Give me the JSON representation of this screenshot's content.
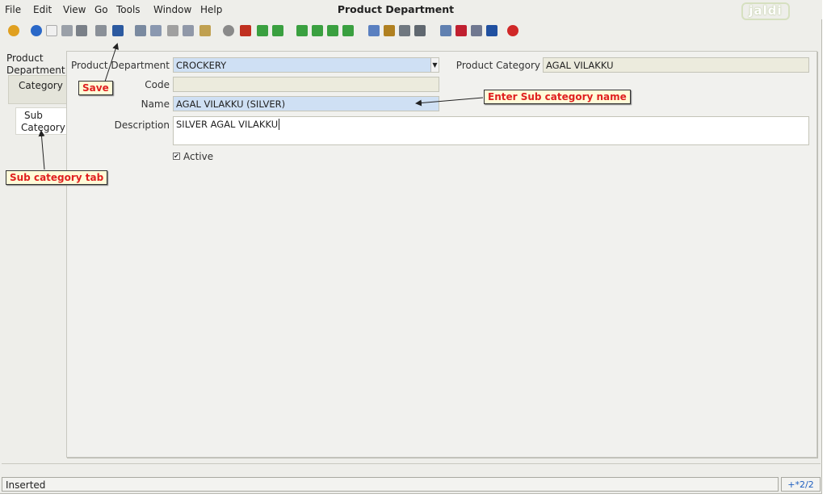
{
  "menu": {
    "file": "File",
    "edit": "Edit",
    "view": "View",
    "go": "Go",
    "tools": "Tools",
    "window": "Window",
    "help": "Help"
  },
  "window_title": "Product Department",
  "logo_text": "jaldi",
  "toolbar_icons": [
    {
      "name": "undo-icon",
      "color": "#e0a020"
    },
    {
      "name": "help-icon",
      "color": "#2a68c8"
    },
    {
      "name": "new-record-icon",
      "color": "#f0f0f0"
    },
    {
      "name": "copy-record-icon",
      "color": "#9aa0a8"
    },
    {
      "name": "delete-record-icon",
      "color": "#7a8088"
    },
    {
      "name": "delete-selection-icon",
      "color": "#8a9098"
    },
    {
      "name": "save-icon",
      "color": "#2c5aa0"
    },
    {
      "name": "refresh-icon",
      "color": "#7a8aa0"
    },
    {
      "name": "find-icon",
      "color": "#8a98b0"
    },
    {
      "name": "attachment-icon",
      "color": "#a0a0a0"
    },
    {
      "name": "chat-icon",
      "color": "#9098a8"
    },
    {
      "name": "grid-toggle-icon",
      "color": "#c0a050"
    },
    {
      "name": "history-icon",
      "color": "#8a8a8a"
    },
    {
      "name": "home-icon",
      "color": "#c03020"
    },
    {
      "name": "back-icon",
      "color": "#3aa040"
    },
    {
      "name": "forward-icon",
      "color": "#3aa040"
    },
    {
      "name": "first-record-icon",
      "color": "#3aa040"
    },
    {
      "name": "previous-record-icon",
      "color": "#3aa040"
    },
    {
      "name": "next-record-icon",
      "color": "#3aa040"
    },
    {
      "name": "last-record-icon",
      "color": "#3aa040"
    },
    {
      "name": "report-icon",
      "color": "#5a80c0"
    },
    {
      "name": "archive-icon",
      "color": "#b08020"
    },
    {
      "name": "print-preview-icon",
      "color": "#707880"
    },
    {
      "name": "print-icon",
      "color": "#606870"
    },
    {
      "name": "zoom-across-icon",
      "color": "#6080b0"
    },
    {
      "name": "workflow-icon",
      "color": "#c02030"
    },
    {
      "name": "product-info-icon",
      "color": "#707890"
    },
    {
      "name": "process-icon",
      "color": "#2050a0"
    },
    {
      "name": "close-window-icon",
      "color": "#d02828"
    }
  ],
  "tabs": {
    "product_department": [
      "Product",
      "Department"
    ],
    "category": "Category",
    "sub_category": [
      "Sub",
      "Category"
    ]
  },
  "form": {
    "product_department_label": "Product Department",
    "product_department_value": "CROCKERY",
    "product_category_label": "Product Category",
    "product_category_value": "AGAL VILAKKU",
    "code_label": "Code",
    "code_value": "",
    "name_label": "Name",
    "name_value": "AGAL VILAKKU (SILVER)",
    "description_label": "Description",
    "description_value": "SILVER AGAL VILAKKU",
    "active_label": "Active",
    "active_checked": true
  },
  "annotations": {
    "save": "Save",
    "enter_name": "Enter Sub category name",
    "sub_category_tab": "Sub category tab"
  },
  "status": {
    "message": "Inserted",
    "record": "+*2/2"
  },
  "colors": {
    "mandatory_field": "#cfe0f4",
    "readonly_field": "#ecebdd",
    "annotation_text": "#e02020",
    "annotation_bg": "#fffbd8"
  }
}
